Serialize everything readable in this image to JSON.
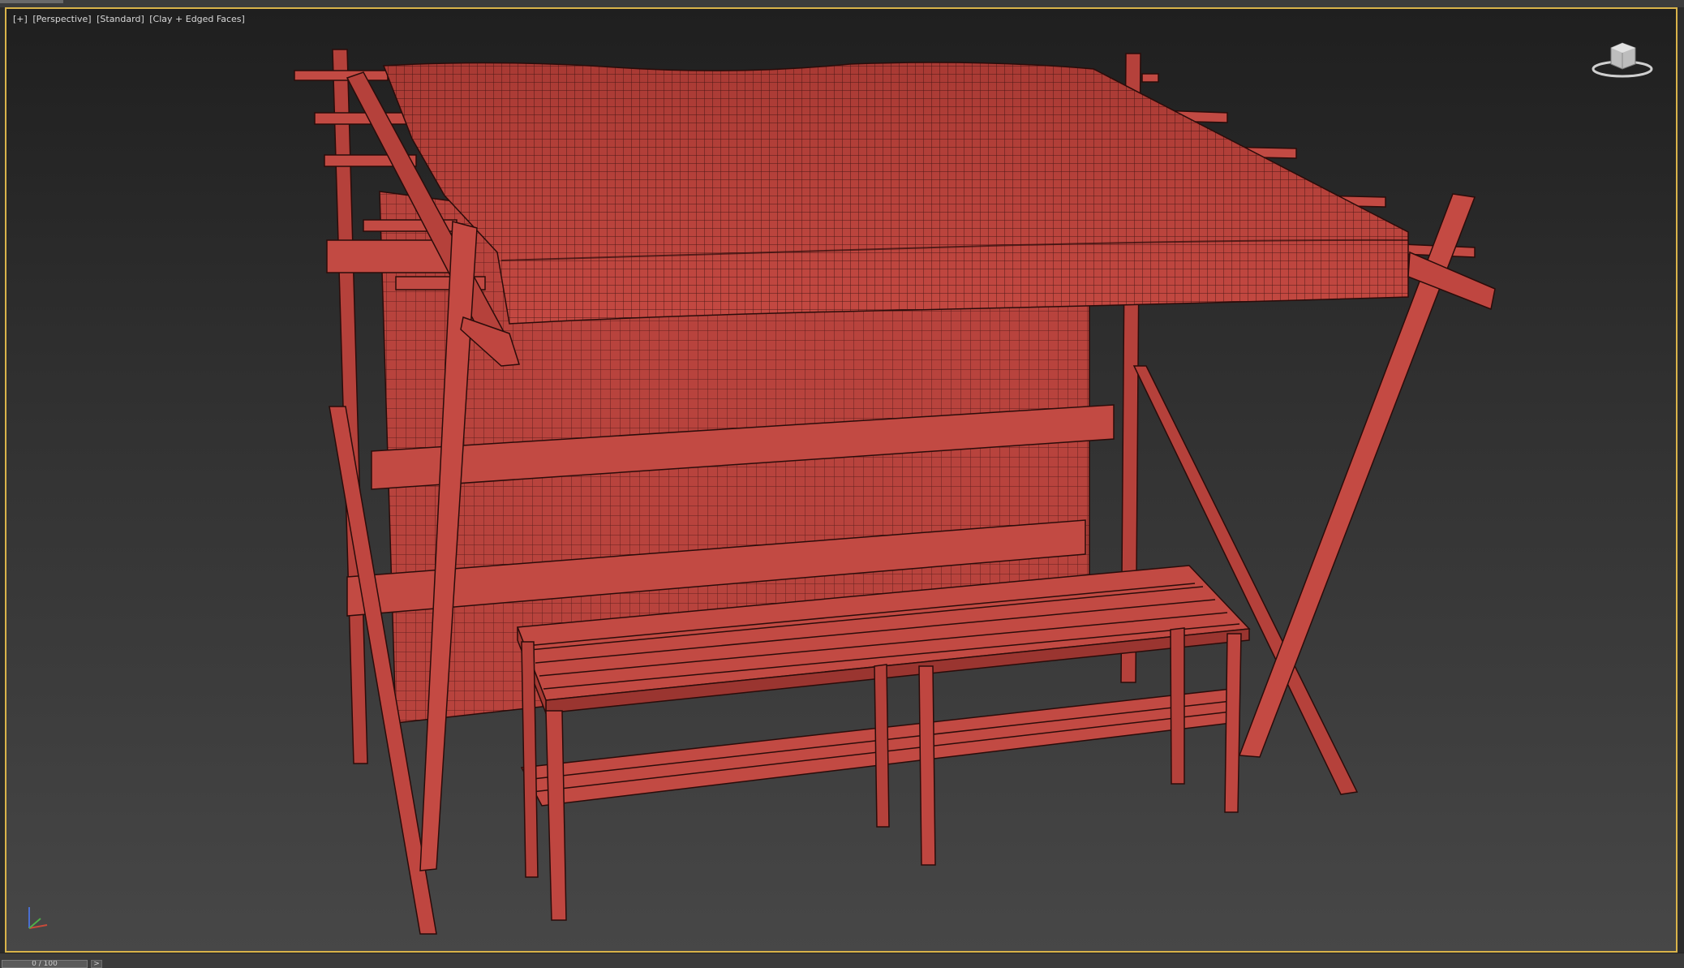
{
  "viewport": {
    "labels": [
      "[+]",
      "[Perspective]",
      "[Standard]",
      "[Clay + Edged Faces]"
    ]
  },
  "colors": {
    "model": "#c0463f",
    "model_dark": "#8a2e29",
    "model_light": "#d65a52",
    "wire": "#2a0c0a",
    "active_border": "#d9b34a",
    "background_top": "#1f1f1f",
    "background_bottom": "#474747"
  },
  "viewcube": {
    "icon": "viewcube-icon"
  },
  "axis_gizmo": {
    "icon": "axis-tripod-icon"
  },
  "timeline": {
    "slider_text": "0 / 100",
    "next_button": ">"
  }
}
